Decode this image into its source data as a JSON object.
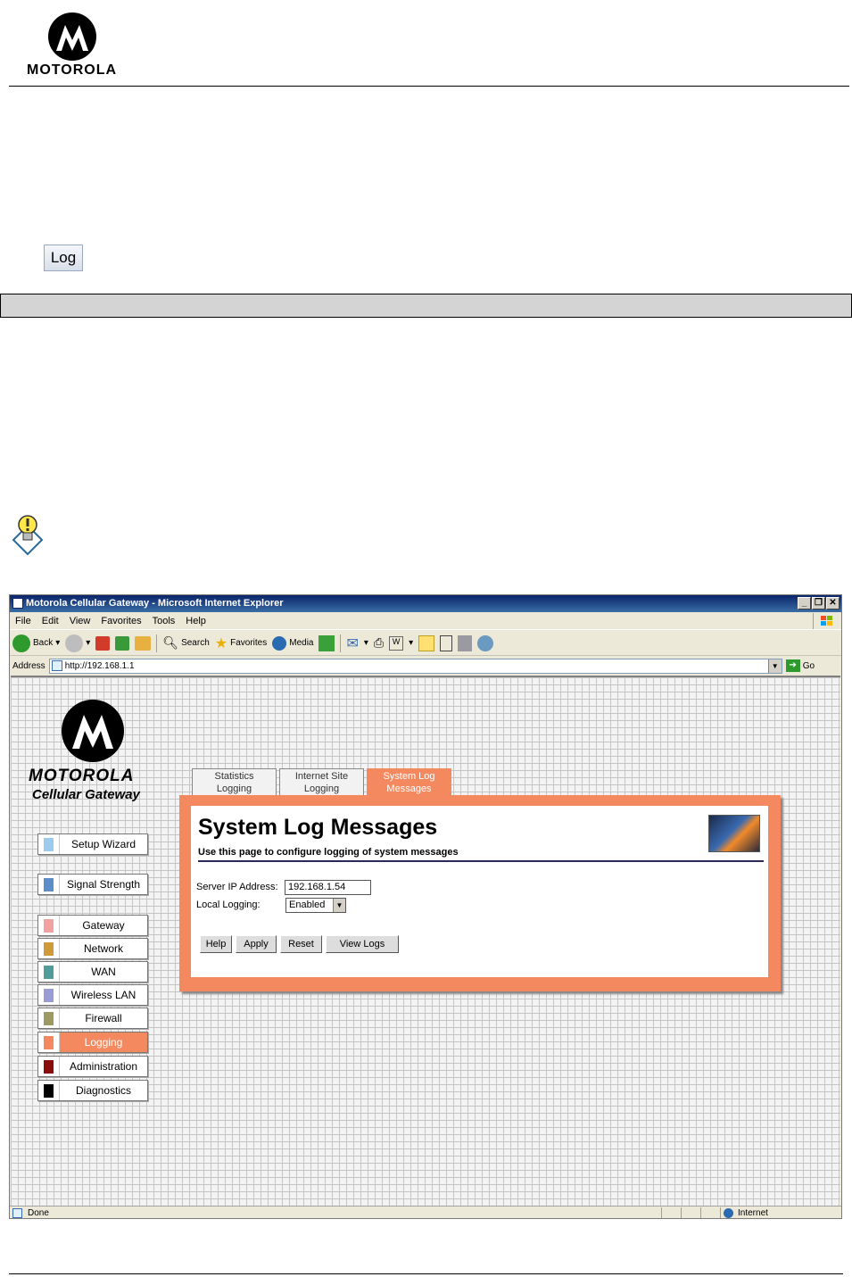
{
  "document": {
    "logo_text": "MOTOROLA",
    "log_button_label": "Log"
  },
  "browser": {
    "title": "Motorola Cellular Gateway - Microsoft Internet Explorer",
    "menu": [
      "File",
      "Edit",
      "View",
      "Favorites",
      "Tools",
      "Help"
    ],
    "toolbar": {
      "back": "Back",
      "search": "Search",
      "favorites": "Favorites",
      "media": "Media"
    },
    "address_label": "Address",
    "address_value": "http://192.168.1.1",
    "go_label": "Go",
    "status_text": "Done",
    "zone_text": "Internet"
  },
  "router": {
    "brand": "MOTOROLA",
    "product": "Cellular Gateway",
    "nav": [
      {
        "label": "Setup Wizard",
        "color": "#9ccbee"
      },
      {
        "label": "Signal Strength",
        "color": "#5b8ec9"
      },
      {
        "label": "Gateway",
        "color": "#f2a0a0"
      },
      {
        "label": "Network",
        "color": "#d09a3a"
      },
      {
        "label": "WAN",
        "color": "#4f9c9a"
      },
      {
        "label": "Wireless LAN",
        "color": "#9a9ad6"
      },
      {
        "label": "Firewall",
        "color": "#9a9a62"
      },
      {
        "label": "Logging",
        "color": "#f4895f"
      },
      {
        "label": "Administration",
        "color": "#8a0d0d"
      },
      {
        "label": "Diagnostics",
        "color": "#000000"
      }
    ],
    "tabs": [
      {
        "line1": "Statistics",
        "line2": "Logging"
      },
      {
        "line1": "Internet Site",
        "line2": "Logging"
      },
      {
        "line1": "System Log",
        "line2": "Messages"
      }
    ],
    "panel": {
      "title": "System Log Messages",
      "subtitle": "Use this page to configure logging of system messages",
      "server_ip_label": "Server IP Address:",
      "server_ip_value": "192.168.1.54",
      "local_logging_label": "Local Logging:",
      "local_logging_value": "Enabled",
      "buttons": [
        "Help",
        "Apply",
        "Reset",
        "View Logs"
      ]
    },
    "accent_color": "#f4895f"
  }
}
